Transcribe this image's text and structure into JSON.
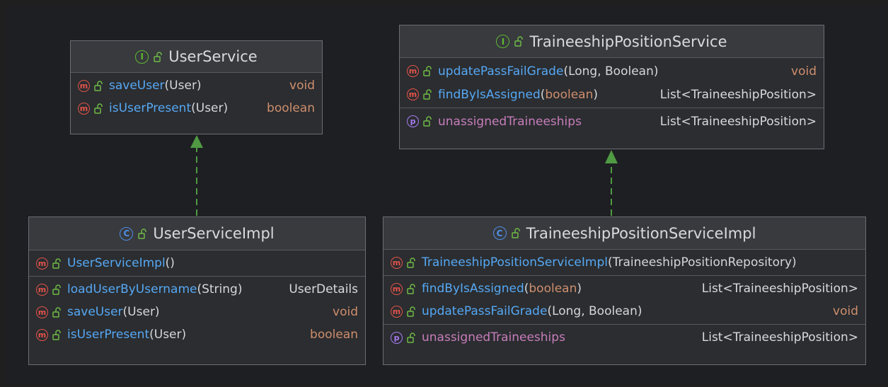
{
  "colors": {
    "background": "#1e1f22",
    "box": "#2b2d30",
    "header": "#383a3e",
    "method_icon": "#e5534b",
    "property_icon": "#a87cf5",
    "interface_icon": "#5fb832",
    "class_icon": "#4f8fe8",
    "method_name": "#56a8f5",
    "property_name": "#c77dbb",
    "keyword": "#cf8e6d",
    "arrow": "#4f9a43"
  },
  "boxes": {
    "user_service": {
      "kind_icon": "interface-icon",
      "kind_letter": "I",
      "name": "UserService",
      "sections": [
        [
          {
            "icon": "m",
            "name": "saveUser",
            "args": "(User)",
            "ret": "void"
          },
          {
            "icon": "m",
            "name": "isUserPresent",
            "args": "(User)",
            "ret": "boolean"
          }
        ]
      ]
    },
    "trainee_service": {
      "kind_icon": "interface-icon",
      "kind_letter": "I",
      "name": "TraineeshipPositionService",
      "sections": [
        [
          {
            "icon": "m",
            "name": "updatePassFailGrade",
            "args": "(Long, Boolean)",
            "ret": "void"
          },
          {
            "icon": "m",
            "name": "findByIsAssigned",
            "args": "(boolean)",
            "ret": "List<TraineeshipPosition>"
          }
        ],
        [
          {
            "icon": "p",
            "name": "unassignedTraineeships",
            "args": "",
            "ret": "List<TraineeshipPosition>"
          }
        ]
      ]
    },
    "user_service_impl": {
      "kind_icon": "class-icon",
      "kind_letter": "C",
      "name": "UserServiceImpl",
      "sections": [
        [
          {
            "icon": "m",
            "name": "UserServiceImpl",
            "args": "()",
            "ret": ""
          }
        ],
        [
          {
            "icon": "m",
            "name": "loadUserByUsername",
            "args": "(String)",
            "ret": "UserDetails"
          },
          {
            "icon": "m",
            "name": "saveUser",
            "args": "(User)",
            "ret": "void"
          },
          {
            "icon": "m",
            "name": "isUserPresent",
            "args": "(User)",
            "ret": "boolean"
          }
        ]
      ]
    },
    "trainee_service_impl": {
      "kind_icon": "class-icon",
      "kind_letter": "C",
      "name": "TraineeshipPositionServiceImpl",
      "sections": [
        [
          {
            "icon": "m",
            "name": "TraineeshipPositionServiceImpl",
            "args": "(TraineeshipPositionRepository)",
            "ret": ""
          }
        ],
        [
          {
            "icon": "m",
            "name": "findByIsAssigned",
            "args": "(boolean)",
            "ret": "List<TraineeshipPosition>"
          },
          {
            "icon": "m",
            "name": "updatePassFailGrade",
            "args": "(Long, Boolean)",
            "ret": "void"
          }
        ],
        [
          {
            "icon": "p",
            "name": "unassignedTraineeships",
            "args": "",
            "ret": "List<TraineeshipPosition>"
          }
        ]
      ]
    }
  },
  "relations": [
    {
      "from": "user_service_impl",
      "to": "user_service",
      "type": "implements"
    },
    {
      "from": "trainee_service_impl",
      "to": "trainee_service",
      "type": "implements"
    }
  ]
}
